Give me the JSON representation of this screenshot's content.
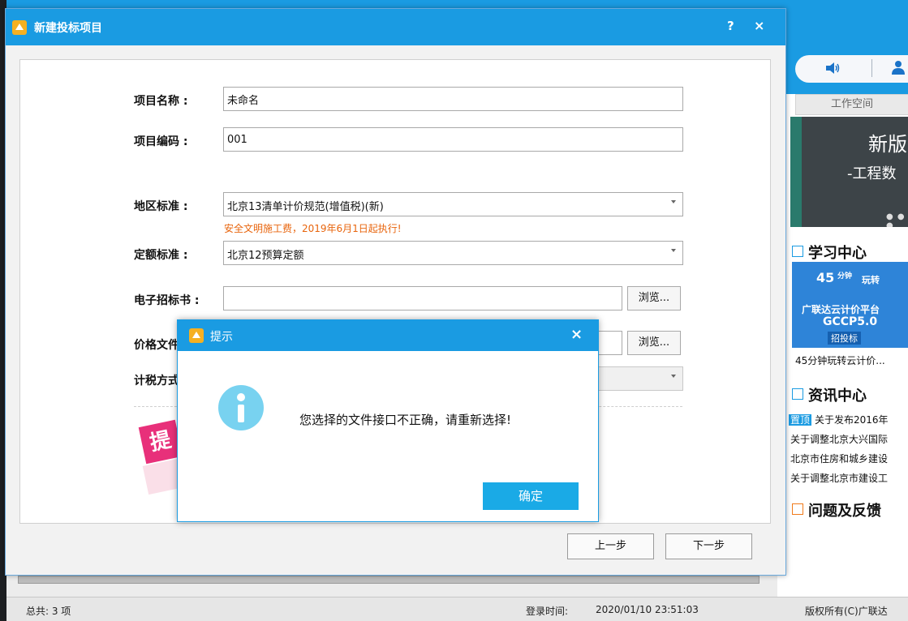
{
  "background": {
    "right_panel": {
      "tab_label": "工作空间",
      "banner_line1": "新版",
      "banner_line2": "-工程数",
      "learning_title": "学习中心",
      "learning_thumb": {
        "line1": "45",
        "line1_sub": "分钟",
        "line2": "玩转",
        "line3": "广联达云计价平台",
        "line4": "GCCP5.0",
        "badge": "招投标"
      },
      "learning_caption": "45分钟玩转云计价...",
      "news_title": "资讯中心",
      "news_items": [
        {
          "tag": "置顶",
          "text": "关于发布2016年"
        },
        {
          "tag": "",
          "text": "关于调整北京大兴国际"
        },
        {
          "tag": "",
          "text": "北京市住房和城乡建设"
        },
        {
          "tag": "",
          "text": "关于调整北京市建设工"
        }
      ],
      "feedback_title": "问题及反馈"
    },
    "statusbar": {
      "total": "总共: 3 项",
      "login_label": "登录时间:",
      "login_time": "2020/01/10 23:51:03",
      "copyright": "版权所有(C)广联达"
    }
  },
  "dialog": {
    "title": "新建投标项目",
    "help": "?",
    "close": "×",
    "fields": {
      "project_name_label": "项目名称 :",
      "project_name_value": "未命名",
      "project_code_label": "项目编码 :",
      "project_code_value": "001",
      "region_label": "地区标准 :",
      "region_value": "北京13清单计价规范(增值税)(新)",
      "region_notice": "安全文明施工费，2019年6月1日起执行!",
      "quota_label": "定额标准 :",
      "quota_value": "北京12预算定额",
      "etender_label": "电子招标书 :",
      "etender_value": "",
      "price_label": "价格文件",
      "price_value": "",
      "tax_label": "计税方式",
      "tax_value": "",
      "browse": "浏览..."
    },
    "promo_char": "提",
    "buttons": {
      "prev": "上一步",
      "next": "下一步"
    }
  },
  "alert": {
    "title": "提示",
    "close": "×",
    "message": "您选择的文件接口不正确，请重新选择!",
    "ok": "确定"
  },
  "colors": {
    "title_blue": "#1a9be2",
    "notice_orange": "#e8640c",
    "info_icon": "#78d2f0",
    "ok_button": "#1aaae6"
  }
}
